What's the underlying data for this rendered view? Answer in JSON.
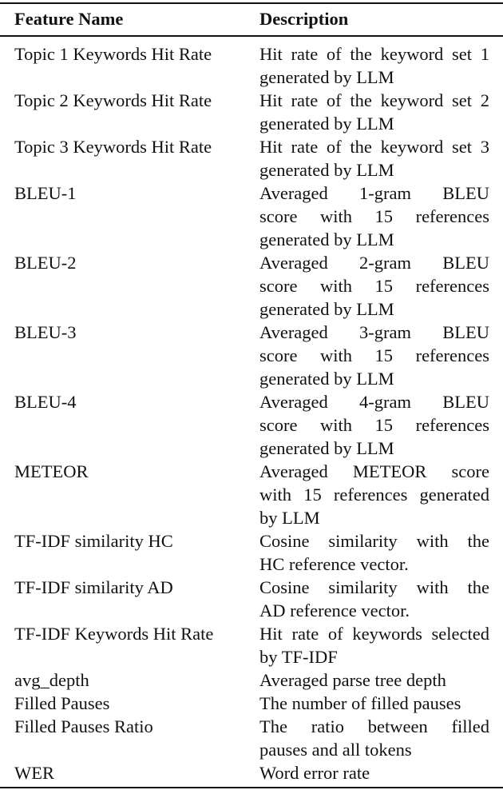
{
  "table": {
    "headers": [
      "Feature Name",
      "Description"
    ],
    "rows": [
      {
        "name": "Topic 1 Keywords Hit Rate",
        "desc": [
          "Hit rate of the keyword set 1",
          "generated by LLM"
        ]
      },
      {
        "name": "Topic 2 Keywords Hit Rate",
        "desc": [
          "Hit rate of the keyword set 2",
          "generated by LLM"
        ]
      },
      {
        "name": "Topic 3 Keywords Hit Rate",
        "desc": [
          "Hit rate of the keyword set 3",
          "generated by LLM"
        ]
      },
      {
        "name": "BLEU-1",
        "desc": [
          "Averaged 1-gram BLEU",
          "score with 15 references",
          "generated by LLM"
        ]
      },
      {
        "name": "BLEU-2",
        "desc": [
          "Averaged 2-gram BLEU",
          "score with 15 references",
          "generated by LLM"
        ]
      },
      {
        "name": "BLEU-3",
        "desc": [
          "Averaged 3-gram BLEU",
          "score with 15 references",
          "generated by LLM"
        ]
      },
      {
        "name": "BLEU-4",
        "desc": [
          "Averaged 4-gram BLEU",
          "score with 15 references",
          "generated by LLM"
        ]
      },
      {
        "name": "METEOR",
        "desc": [
          "Averaged METEOR score",
          "with 15 references generated",
          "by LLM"
        ]
      },
      {
        "name": "TF-IDF similarity HC",
        "desc": [
          "Cosine similarity with the",
          "HC reference vector."
        ]
      },
      {
        "name": "TF-IDF similarity AD",
        "desc": [
          "Cosine similarity with the",
          "AD reference vector."
        ]
      },
      {
        "name": "TF-IDF Keywords Hit Rate",
        "desc": [
          "Hit rate of keywords selected",
          "by TF-IDF"
        ]
      },
      {
        "name": "avg_depth",
        "desc": [
          "Averaged parse tree depth"
        ]
      },
      {
        "name": "Filled Pauses",
        "desc": [
          "The number of filled pauses"
        ]
      },
      {
        "name": "Filled Pauses Ratio",
        "desc": [
          "The ratio between filled",
          "pauses and all tokens"
        ]
      },
      {
        "name": "WER",
        "desc": [
          "Word error rate"
        ]
      }
    ]
  }
}
